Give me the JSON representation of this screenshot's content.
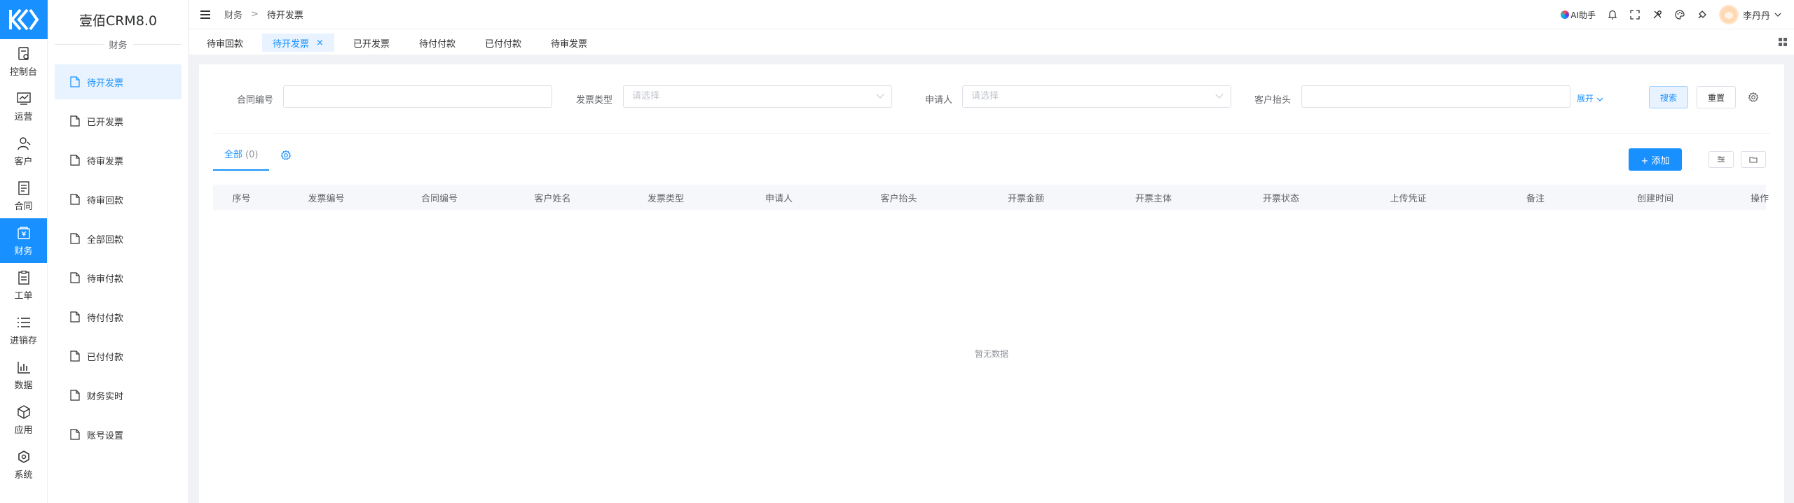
{
  "app": {
    "title": "壹佰CRM8.0",
    "section": "财务"
  },
  "rail": [
    {
      "label": "控制台",
      "icon": "dashboard-icon"
    },
    {
      "label": "运营",
      "icon": "operations-icon"
    },
    {
      "label": "客户",
      "icon": "customer-icon"
    },
    {
      "label": "合同",
      "icon": "contract-icon"
    },
    {
      "label": "财务",
      "icon": "finance-icon",
      "active": true
    },
    {
      "label": "工单",
      "icon": "workorder-icon"
    },
    {
      "label": "进销存",
      "icon": "inventory-icon"
    },
    {
      "label": "数据",
      "icon": "data-chart-icon"
    },
    {
      "label": "应用",
      "icon": "apps-cube-icon"
    },
    {
      "label": "系统",
      "icon": "system-hex-icon"
    }
  ],
  "menu": [
    {
      "label": "待开发票",
      "active": true
    },
    {
      "label": "已开发票"
    },
    {
      "label": "待审发票"
    },
    {
      "label": "待审回款"
    },
    {
      "label": "全部回款"
    },
    {
      "label": "待审付款"
    },
    {
      "label": "待付付款"
    },
    {
      "label": "已付付款"
    },
    {
      "label": "财务实时"
    },
    {
      "label": "账号设置"
    }
  ],
  "breadcrumb": {
    "parent": "财务",
    "separator": ">",
    "current": "待开发票"
  },
  "header": {
    "ai_label": "AI助手",
    "user_name": "李丹丹"
  },
  "tabs": [
    {
      "label": "待审回款"
    },
    {
      "label": "待开发票",
      "active": true,
      "close": "×"
    },
    {
      "label": "已开发票"
    },
    {
      "label": "待付付款"
    },
    {
      "label": "已付付款"
    },
    {
      "label": "待审发票"
    }
  ],
  "filters": {
    "contract_no_label": "合同编号",
    "contract_no_value": "",
    "invoice_type_label": "发票类型",
    "invoice_type_placeholder": "请选择",
    "applicant_label": "申请人",
    "applicant_placeholder": "请选择",
    "customer_title_label": "客户抬头",
    "customer_title_value": "",
    "expand_label": "展开",
    "search_label": "搜索",
    "reset_label": "重置"
  },
  "list": {
    "tab_label": "全部",
    "tab_count": "(0)",
    "add_label": "+ 添加",
    "columns": [
      "序号",
      "发票编号",
      "合同编号",
      "客户姓名",
      "发票类型",
      "申请人",
      "客户抬头",
      "开票金额",
      "开票主体",
      "开票状态",
      "上传凭证",
      "备注",
      "创建时间",
      "操作"
    ],
    "empty_text": "暂无数据"
  },
  "colors": {
    "accent": "#1890ff",
    "accent_light": "#e8f3ff"
  }
}
